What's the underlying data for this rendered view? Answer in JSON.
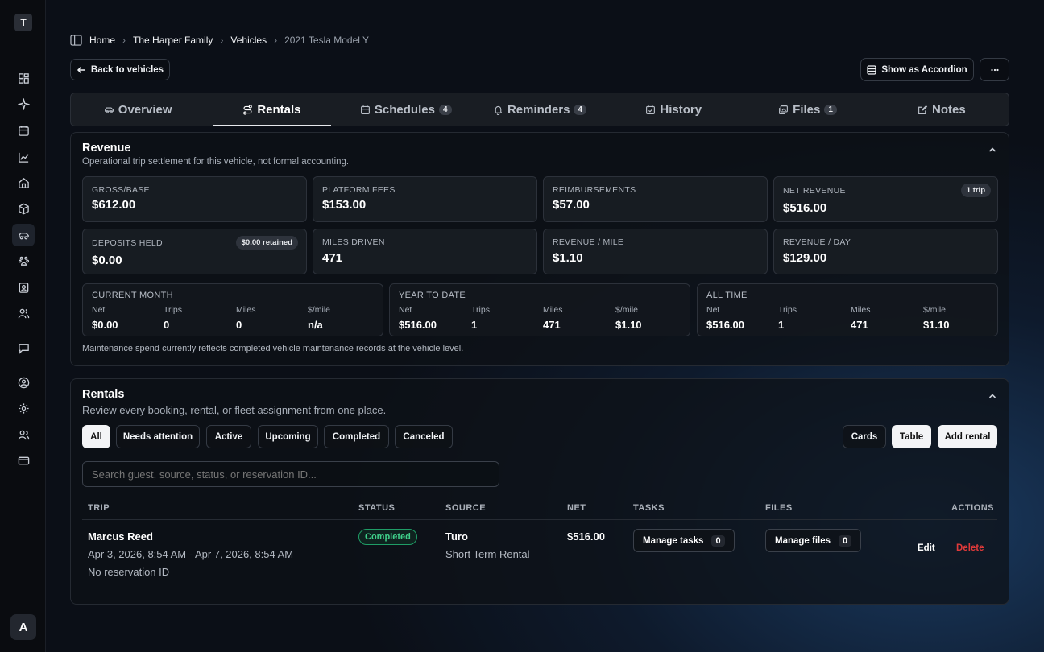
{
  "sidebar": {
    "logo_letter": "T",
    "avatar_letter": "A",
    "icons": [
      "dashboard-icon",
      "sparkle-icon",
      "calendar-icon",
      "chart-icon",
      "home-icon",
      "box-icon",
      "car-icon",
      "pets-icon",
      "contacts-icon",
      "users-icon",
      "chat-icon",
      "user-circle-icon",
      "settings-icon",
      "team-icon",
      "credit-card-icon"
    ],
    "active_icon": "car-icon"
  },
  "breadcrumb": {
    "items": [
      "Home",
      "The Harper Family",
      "Vehicles"
    ],
    "current": "2021 Tesla Model Y"
  },
  "header": {
    "back_label": "Back to vehicles",
    "accordion_label": "Show as Accordion"
  },
  "tabs": [
    {
      "label": "Overview",
      "count": ""
    },
    {
      "label": "Rentals",
      "count": ""
    },
    {
      "label": "Schedules",
      "count": "4"
    },
    {
      "label": "Reminders",
      "count": "4"
    },
    {
      "label": "History",
      "count": ""
    },
    {
      "label": "Files",
      "count": "1"
    },
    {
      "label": "Notes",
      "count": ""
    }
  ],
  "revenue": {
    "title": "Revenue",
    "subtitle": "Operational trip settlement for this vehicle, not formal accounting.",
    "stats": [
      {
        "label": "GROSS/BASE",
        "value": "$612.00",
        "pill": ""
      },
      {
        "label": "PLATFORM FEES",
        "value": "$153.00",
        "pill": ""
      },
      {
        "label": "REIMBURSEMENTS",
        "value": "$57.00",
        "pill": ""
      },
      {
        "label": "NET REVENUE",
        "value": "$516.00",
        "pill": "1 trip"
      },
      {
        "label": "DEPOSITS HELD",
        "value": "$0.00",
        "pill": "$0.00 retained"
      },
      {
        "label": "MILES DRIVEN",
        "value": "471",
        "pill": ""
      },
      {
        "label": "REVENUE / MILE",
        "value": "$1.10",
        "pill": ""
      },
      {
        "label": "REVENUE / DAY",
        "value": "$129.00",
        "pill": ""
      }
    ],
    "periods": [
      {
        "title": "CURRENT MONTH",
        "cols": [
          {
            "l": "Net",
            "v": "$0.00"
          },
          {
            "l": "Trips",
            "v": "0"
          },
          {
            "l": "Miles",
            "v": "0"
          },
          {
            "l": "$/mile",
            "v": "n/a"
          }
        ]
      },
      {
        "title": "YEAR TO DATE",
        "cols": [
          {
            "l": "Net",
            "v": "$516.00"
          },
          {
            "l": "Trips",
            "v": "1"
          },
          {
            "l": "Miles",
            "v": "471"
          },
          {
            "l": "$/mile",
            "v": "$1.10"
          }
        ]
      },
      {
        "title": "ALL TIME",
        "cols": [
          {
            "l": "Net",
            "v": "$516.00"
          },
          {
            "l": "Trips",
            "v": "1"
          },
          {
            "l": "Miles",
            "v": "471"
          },
          {
            "l": "$/mile",
            "v": "$1.10"
          }
        ]
      }
    ],
    "note": "Maintenance spend currently reflects completed vehicle maintenance records at the vehicle level."
  },
  "rentals": {
    "title": "Rentals",
    "subtitle": "Review every booking, rental, or fleet assignment from one place.",
    "filters": [
      "All",
      "Needs attention",
      "Active",
      "Upcoming",
      "Completed",
      "Canceled"
    ],
    "active_filter": "All",
    "view_buttons": [
      "Cards",
      "Table"
    ],
    "active_view": "Table",
    "add_label": "Add rental",
    "search_placeholder": "Search guest, source, status, or reservation ID...",
    "columns": [
      "TRIP",
      "STATUS",
      "SOURCE",
      "NET",
      "TASKS",
      "FILES",
      "ACTIONS"
    ],
    "rows": [
      {
        "guest": "Marcus Reed",
        "dates": "Apr 3, 2026, 8:54 AM - Apr 7, 2026, 8:54 AM",
        "reservation": "No reservation ID",
        "status": "Completed",
        "source": "Turo",
        "source_type": "Short Term Rental",
        "net": "$516.00",
        "tasks_label": "Manage tasks",
        "tasks_count": "0",
        "files_label": "Manage files",
        "files_count": "0",
        "edit_label": "Edit",
        "delete_label": "Delete"
      }
    ]
  }
}
